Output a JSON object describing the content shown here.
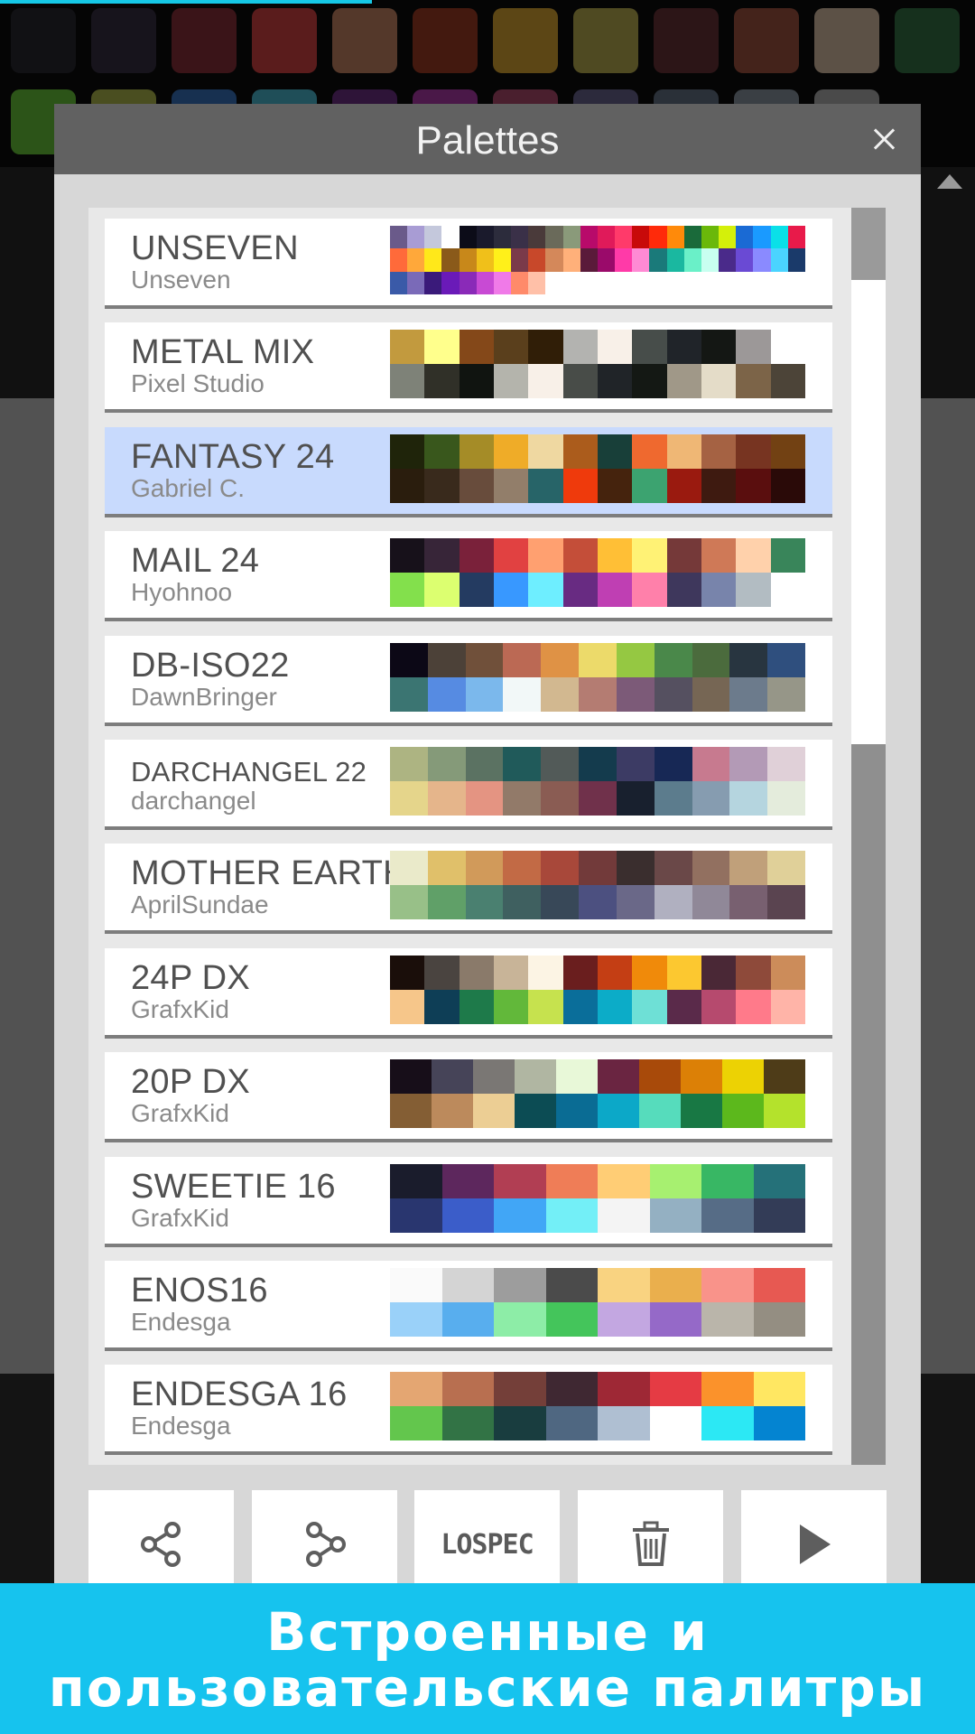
{
  "dialog": {
    "title": "Palettes"
  },
  "toolbar": {
    "lospec_label": "LOSPEC",
    "buttons": [
      {
        "icon": "share-icon"
      },
      {
        "icon": "share-alt-icon"
      },
      {
        "icon": "lospec-logo"
      },
      {
        "icon": "trash-icon"
      },
      {
        "icon": "play-icon"
      }
    ]
  },
  "banner": {
    "line1": "Встроенные и",
    "line2": "пользовательские палитры"
  },
  "background_swatches": [
    "#111114",
    "#17141c",
    "#3a1418",
    "#5a1c1c",
    "#54382a",
    "#43190f",
    "#5c4615",
    "#4f4a22",
    "#2c1517",
    "#44231b",
    "#5c5146",
    "#16301d",
    "#2c5418",
    "#4a4e20",
    "#173050",
    "#1f4e58",
    "#2e1438",
    "#4a1848",
    "#4a1f2e",
    "#2c2a3c",
    "#2a3038",
    "#3a3f44",
    "#4a4a4a"
  ],
  "palettes": [
    {
      "name": "UNSEVEN",
      "author": "Unseven",
      "selected": false,
      "columns": 24,
      "colors": [
        "#6a5a8a",
        "#a89cd4",
        "#c4c8dc",
        "#ffffff",
        "#0c0c18",
        "#1a1a2c",
        "#2c2c3c",
        "#3a3048",
        "#4a3a3a",
        "#6a6a5a",
        "#8a9a7a",
        "#b80a6a",
        "#e01a5a",
        "#ff3a6a",
        "#c80a0a",
        "#ff2a0a",
        "#ff8a0a",
        "#1a6a3a",
        "#6ab80a",
        "#d4f00a",
        "#1a6ad4",
        "#1a9aff",
        "#0ae0e8",
        "#e81a4a",
        "#ff6a3a",
        "#ffa83a",
        "#ffe81a",
        "#8a5a1a",
        "#c8881a",
        "#f0c01a",
        "#fff01a",
        "#7a3a4a",
        "#c8482a",
        "#d4885a",
        "#ffb07a",
        "#5a1a3a",
        "#9a0a6a",
        "#ff3aa8",
        "#ff8ad4",
        "#1a7a7a",
        "#1ab8a0",
        "#6af0c8",
        "#c8fff0",
        "#4a2a8a",
        "#6a4ad4",
        "#8a8aff",
        "#4ad4ff",
        "#1a3a6a",
        "#3a5aa8",
        "#7a6ab8",
        "#3a1a7a",
        "#6a1ab8",
        "#8a2ab8",
        "#c84ad4",
        "#f07ae8",
        "#ff8a6a",
        "#ffc0a8"
      ]
    },
    {
      "name": "METAL MIX",
      "author": "Pixel Studio",
      "selected": false,
      "columns": 12,
      "colors": [
        "#c29a3e",
        "#ffff8c",
        "#844819",
        "#5a3f1c",
        "#301e07",
        "#b3b3b0",
        "#f8f0e8",
        "#474d4a",
        "#202429",
        "#141714",
        "#9c9898",
        "#ffffff",
        "#7e8278",
        "#303028",
        "#101410",
        "#b4b4ac",
        "#f8f0e8",
        "#484c48",
        "#202428",
        "#141814",
        "#a09888",
        "#e4dcc8",
        "#7c6448",
        "#4c4438"
      ]
    },
    {
      "name": "FANTASY 24",
      "author": "Gabriel C.",
      "selected": true,
      "columns": 12,
      "colors": [
        "#1f240a",
        "#39571c",
        "#a58c27",
        "#efac28",
        "#efd8a1",
        "#ab5c1c",
        "#183f39",
        "#ef692f",
        "#efb775",
        "#a56243",
        "#773421",
        "#724113",
        "#2a1d0d",
        "#392a1c",
        "#684c3c",
        "#927e6a",
        "#276468",
        "#ef3a0c",
        "#45230d",
        "#3ca370",
        "#9a1a0f",
        "#3e1a10",
        "#5a0e0e",
        "#2a0a08"
      ]
    },
    {
      "name": "MAIL 24",
      "author": "Hyohnoo",
      "selected": false,
      "columns": 12,
      "colors": [
        "#17111a",
        "#372538",
        "#7a213a",
        "#e14141",
        "#ffa070",
        "#c44e39",
        "#ffbf36",
        "#fff275",
        "#753939",
        "#cf7957",
        "#ffd1ab",
        "#39855a",
        "#83e04c",
        "#dcff70",
        "#243b61",
        "#3898ff",
        "#6eeeff",
        "#682b82",
        "#bf3fb3",
        "#ff80aa",
        "#3e375c",
        "#7884ab",
        "#b2bcc2",
        "#ffffff"
      ]
    },
    {
      "name": "DB-ISO22",
      "author": "DawnBringer",
      "selected": false,
      "columns": 11,
      "colors": [
        "#0c0816",
        "#4c4138",
        "#70503a",
        "#bb6954",
        "#df9245",
        "#ecda6a",
        "#95c842",
        "#4a884a",
        "#4b6b3d",
        "#283540",
        "#2f4f7e",
        "#3b7572",
        "#568be2",
        "#7bb8ec",
        "#f2f8f8",
        "#d2b890",
        "#b47c72",
        "#7c5a78",
        "#555060",
        "#766654",
        "#6c7b8c",
        "#969688"
      ]
    },
    {
      "name": "DARCHANGEL 22",
      "author": "darchangel",
      "selected": false,
      "columns": 11,
      "colors": [
        "#adb482",
        "#859a79",
        "#5b7262",
        "#205a5a",
        "#525a58",
        "#143b4d",
        "#3c3b64",
        "#172855",
        "#c77a8f",
        "#b39ab6",
        "#e0d0d8",
        "#e5d58b",
        "#e5b58b",
        "#e49482",
        "#927a69",
        "#8a5c53",
        "#70314b",
        "#18202e",
        "#5c7c8d",
        "#869cb0",
        "#b5d5df",
        "#e4ecdc"
      ]
    },
    {
      "name": "MOTHER EARTH",
      "author": "AprilSundae",
      "selected": false,
      "columns": 11,
      "colors": [
        "#eaeaca",
        "#e0c06a",
        "#d19a5a",
        "#c26a45",
        "#a8483a",
        "#723a3a",
        "#3a2e2e",
        "#6a4848",
        "#927060",
        "#c0a07a",
        "#e0d099",
        "#98c088",
        "#60a068",
        "#4a8070",
        "#3f6060",
        "#384858",
        "#4c5080",
        "#6a6888",
        "#b0b0c0",
        "#908898",
        "#786070",
        "#5a4450"
      ]
    },
    {
      "name": "24P DX",
      "author": "GrafxKid",
      "selected": false,
      "columns": 12,
      "colors": [
        "#1a0e0a",
        "#4a4440",
        "#8a7a6a",
        "#c8b498",
        "#fcf4e4",
        "#6a1e1e",
        "#c43e14",
        "#f08a0a",
        "#fcc830",
        "#4a2836",
        "#8e4a3a",
        "#cc8c5a",
        "#f6c68a",
        "#0e3e56",
        "#1e7a4a",
        "#62b83a",
        "#c6e24e",
        "#0a6e9a",
        "#0cacc8",
        "#6ee0d6",
        "#5a2a4a",
        "#b64a6e",
        "#ff7a8a",
        "#ffb4a8"
      ]
    },
    {
      "name": "20P DX",
      "author": "GrafxKid",
      "selected": false,
      "columns": 10,
      "colors": [
        "#170e19",
        "#464458",
        "#7a7774",
        "#b0b6a2",
        "#e8f8d8",
        "#6a2541",
        "#a84a0a",
        "#dc8006",
        "#ecd204",
        "#4e3c18",
        "#845e34",
        "#bc8a5c",
        "#ecce94",
        "#0c4c54",
        "#0a6c94",
        "#0ca8c8",
        "#56dcbc",
        "#187844",
        "#5cb81c",
        "#b4e22c"
      ]
    },
    {
      "name": "SWEETIE 16",
      "author": "GrafxKid",
      "selected": false,
      "columns": 8,
      "colors": [
        "#1a1c2c",
        "#5d275d",
        "#b13e53",
        "#ef7d57",
        "#ffcd75",
        "#a7f070",
        "#38b764",
        "#257179",
        "#29366f",
        "#3b5dc9",
        "#41a6f6",
        "#73eff7",
        "#f4f4f4",
        "#94b0c2",
        "#566c86",
        "#333c57"
      ]
    },
    {
      "name": "ENOS16",
      "author": "Endesga",
      "selected": false,
      "columns": 8,
      "colors": [
        "#fafafa",
        "#d4d4d4",
        "#9d9d9d",
        "#4b4b4b",
        "#f9d381",
        "#eaaf4d",
        "#f9938a",
        "#e75952",
        "#9ad1f9",
        "#58aeee",
        "#8deda7",
        "#44c55b",
        "#c3a7e1",
        "#9569c8",
        "#bab5aa",
        "#948e82"
      ]
    },
    {
      "name": "ENDESGA 16",
      "author": "Endesga",
      "selected": false,
      "columns": 8,
      "colors": [
        "#e4a672",
        "#b86f50",
        "#743f39",
        "#3f2832",
        "#9e2835",
        "#e53b44",
        "#fb922b",
        "#ffe762",
        "#63c64d",
        "#327345",
        "#193d3f",
        "#4f6781",
        "#afbfd2",
        "#ffffff",
        "#2ce8f4",
        "#0484d1"
      ]
    }
  ]
}
